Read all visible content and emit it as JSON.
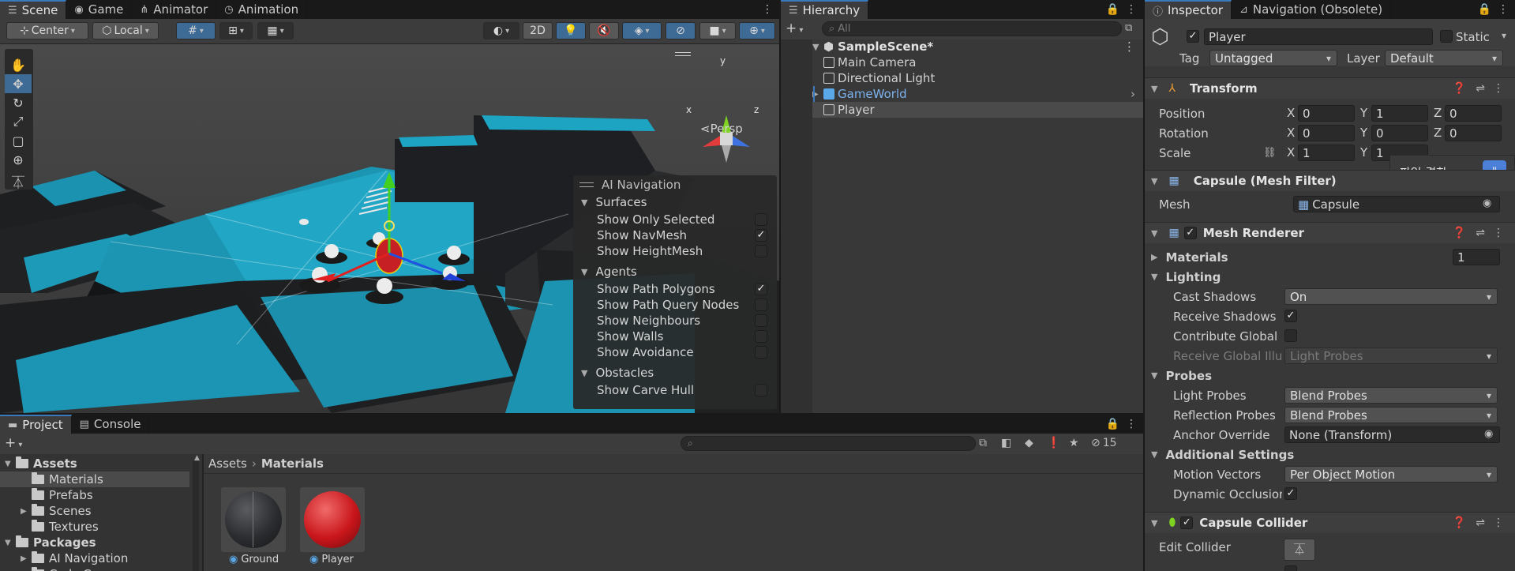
{
  "scene_panel": {
    "tabs": [
      {
        "label": "Scene",
        "icon": "scene-icon"
      },
      {
        "label": "Game",
        "icon": "gamepad-icon"
      },
      {
        "label": "Animator",
        "icon": "animator-icon"
      },
      {
        "label": "Animation",
        "icon": "clock-icon"
      }
    ],
    "toolbar": {
      "pivot_mode": "Center",
      "pivot_rotation": "Local",
      "mode_2d": "2D"
    },
    "persp_label": "Persp",
    "gizmo_axes": {
      "x": "x",
      "y": "y",
      "z": "z"
    }
  },
  "ai_navigation": {
    "title": "AI Navigation",
    "sections": [
      {
        "label": "Surfaces",
        "items": [
          {
            "label": "Show Only Selected",
            "checked": false
          },
          {
            "label": "Show NavMesh",
            "checked": true
          },
          {
            "label": "Show HeightMesh",
            "checked": false
          }
        ]
      },
      {
        "label": "Agents",
        "items": [
          {
            "label": "Show Path Polygons",
            "checked": true
          },
          {
            "label": "Show Path Query Nodes",
            "checked": false
          },
          {
            "label": "Show Neighbours",
            "checked": false
          },
          {
            "label": "Show Walls",
            "checked": false
          },
          {
            "label": "Show Avoidance",
            "checked": false
          }
        ]
      },
      {
        "label": "Obstacles",
        "items": [
          {
            "label": "Show Carve Hull",
            "checked": false
          }
        ]
      }
    ],
    "check_mark": "✓"
  },
  "hierarchy": {
    "tab_label": "Hierarchy",
    "search_placeholder": "All",
    "scene_name": "SampleScene*",
    "items": [
      {
        "label": "Main Camera"
      },
      {
        "label": "Directional Light"
      },
      {
        "label": "GameWorld",
        "prefab": true
      },
      {
        "label": "Player",
        "selected": true
      }
    ]
  },
  "inspector": {
    "tabs": [
      {
        "label": "Inspector"
      },
      {
        "label": "Navigation (Obsolete)"
      }
    ],
    "object_name": "Player",
    "static_label": "Static",
    "tag_label": "Tag",
    "tag_value": "Untagged",
    "layer_label": "Layer",
    "layer_value": "Default",
    "tooltip_text": "파일 결합",
    "transform": {
      "title": "Transform",
      "position_label": "Position",
      "rotation_label": "Rotation",
      "scale_label": "Scale",
      "position": {
        "x": "0",
        "y": "1",
        "z": "0"
      },
      "rotation": {
        "x": "0",
        "y": "0",
        "z": "0"
      },
      "scale": {
        "x": "1",
        "y": "1"
      },
      "axis_labels": {
        "x": "X",
        "y": "Y",
        "z": "Z"
      }
    },
    "mesh_filter": {
      "title": "Capsule (Mesh Filter)",
      "mesh_label": "Mesh",
      "mesh_value": "Capsule"
    },
    "mesh_renderer": {
      "title": "Mesh Renderer",
      "materials_label": "Materials",
      "materials_count": "1",
      "lighting_label": "Lighting",
      "cast_shadows_label": "Cast Shadows",
      "cast_shadows_value": "On",
      "receive_shadows_label": "Receive Shadows",
      "contribute_gi_label": "Contribute Global Il",
      "receive_gi_label": "Receive Global Illur",
      "receive_gi_value": "Light Probes",
      "probes_label": "Probes",
      "light_probes_label": "Light Probes",
      "light_probes_value": "Blend Probes",
      "reflection_probes_label": "Reflection Probes",
      "reflection_probes_value": "Blend Probes",
      "anchor_override_label": "Anchor Override",
      "anchor_override_value": "None (Transform)",
      "additional_settings_label": "Additional Settings",
      "motion_vectors_label": "Motion Vectors",
      "motion_vectors_value": "Per Object Motion",
      "dynamic_occlusion_label": "Dynamic Occlusion"
    },
    "capsule_collider": {
      "title": "Capsule Collider",
      "edit_collider_label": "Edit Collider"
    }
  },
  "project": {
    "tabs": [
      {
        "label": "Project"
      },
      {
        "label": "Console"
      }
    ],
    "hidden_count": "15",
    "tree": [
      {
        "label": "Assets",
        "level": 0,
        "bold": true
      },
      {
        "label": "Materials",
        "level": 1,
        "selected": true
      },
      {
        "label": "Prefabs",
        "level": 1
      },
      {
        "label": "Scenes",
        "level": 1
      },
      {
        "label": "Textures",
        "level": 1
      },
      {
        "label": "Packages",
        "level": 0,
        "bold": true
      },
      {
        "label": "AI Navigation",
        "level": 1
      },
      {
        "label": "Code Coverage",
        "level": 1
      }
    ],
    "breadcrumb": [
      "Assets",
      "Materials"
    ],
    "assets": [
      {
        "label": "Ground",
        "color": "#2b2d30"
      },
      {
        "label": "Player",
        "color": "#c9161b"
      }
    ]
  },
  "colors": {
    "accent_blue": "#3a79bb",
    "navmesh": "#1fa3c2",
    "prefab_text": "#7cb3ee"
  }
}
